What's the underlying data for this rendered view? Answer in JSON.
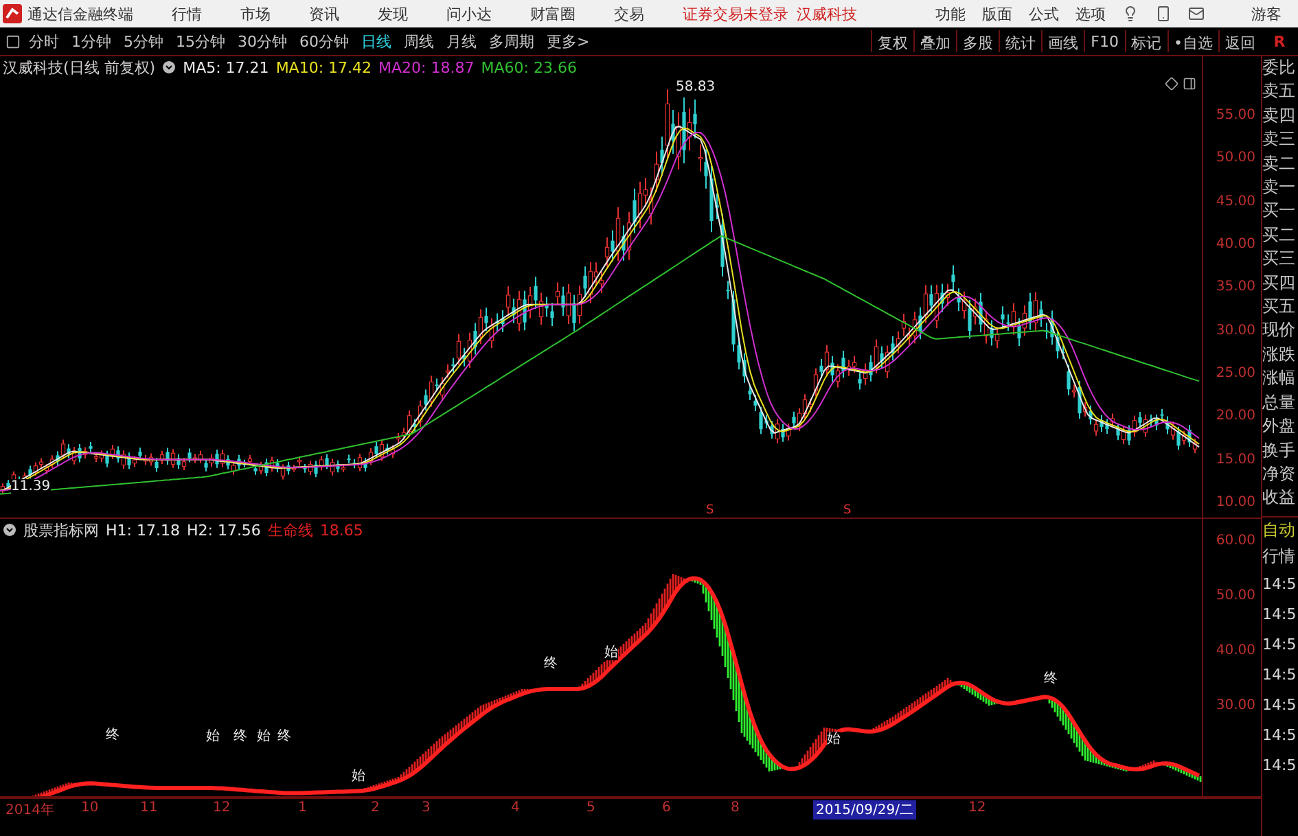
{
  "app": {
    "title": "通达信金融终端"
  },
  "menu": [
    {
      "label": "行情"
    },
    {
      "label": "市场"
    },
    {
      "label": "资讯"
    },
    {
      "label": "发现"
    },
    {
      "label": "问小达"
    },
    {
      "label": "财富圈"
    },
    {
      "label": "交易"
    }
  ],
  "notice": [
    "证券交易未登录",
    "汉威科技"
  ],
  "tools": [
    {
      "label": "功能"
    },
    {
      "label": "版面"
    },
    {
      "label": "公式"
    },
    {
      "label": "选项"
    }
  ],
  "user": "游客",
  "periods": [
    {
      "label": "分时",
      "selected": false
    },
    {
      "label": "1分钟",
      "selected": false
    },
    {
      "label": "5分钟",
      "selected": false
    },
    {
      "label": "15分钟",
      "selected": false
    },
    {
      "label": "30分钟",
      "selected": false
    },
    {
      "label": "60分钟",
      "selected": false
    },
    {
      "label": "日线",
      "selected": true
    },
    {
      "label": "周线",
      "selected": false
    },
    {
      "label": "月线",
      "selected": false
    },
    {
      "label": "多周期",
      "selected": false
    },
    {
      "label": "更多>",
      "selected": false
    }
  ],
  "actions": [
    "复权",
    "叠加",
    "多股",
    "统计",
    "画线",
    "F10",
    "标记",
    "•自选",
    "返回"
  ],
  "corner": "R",
  "price_chart": {
    "title": "汉威科技(日线 前复权)",
    "indicators": [
      {
        "text": "MA5: 17.21",
        "color": "#e8e8e8"
      },
      {
        "text": "MA10: 17.42",
        "color": "#e8e020"
      },
      {
        "text": "MA20: 18.87",
        "color": "#d030d0"
      },
      {
        "text": "MA60: 23.66",
        "color": "#30c030"
      }
    ],
    "high": "58.83",
    "low": "11.39",
    "signals": [
      "S",
      "S"
    ],
    "ticks": [
      "55.00",
      "50.00",
      "45.00",
      "40.00",
      "35.00",
      "30.00",
      "25.00",
      "20.00",
      "15.00",
      "10.00"
    ]
  },
  "indicator_chart": {
    "title": "股票指标网",
    "values": [
      {
        "text": "H1: 17.18",
        "color": "#e8e8e8"
      },
      {
        "text": "H2: 17.56",
        "color": "#e8e8e8"
      },
      {
        "text": "生命线",
        "color": "#e02020"
      },
      {
        "text": "18.65",
        "color": "#e02020"
      }
    ],
    "marks": [
      "终",
      "始",
      "终",
      "始",
      "终",
      "始",
      "终",
      "始",
      "始",
      "终"
    ],
    "ticks": [
      "60.00",
      "50.00",
      "40.00",
      "30.00"
    ]
  },
  "quote_labels": [
    "委比",
    "卖五",
    "卖四",
    "卖三",
    "卖二",
    "卖一",
    "买一",
    "买二",
    "买三",
    "买四",
    "买五",
    "现价",
    "涨跌",
    "涨幅",
    "总量",
    "外盘",
    "换手",
    "净资",
    "收益"
  ],
  "ticker_tabs": [
    "自动",
    "行情"
  ],
  "ticker_times": [
    "14:5",
    "14:5",
    "14:5",
    "14:5",
    "14:5",
    "14:5",
    "14:5"
  ],
  "x_axis": [
    {
      "label": "2014年",
      "selected": false
    },
    {
      "label": "10",
      "selected": false
    },
    {
      "label": "11",
      "selected": false
    },
    {
      "label": "12",
      "selected": false
    },
    {
      "label": "1",
      "selected": false
    },
    {
      "label": "2",
      "selected": false
    },
    {
      "label": "3",
      "selected": false
    },
    {
      "label": "4",
      "selected": false
    },
    {
      "label": "5",
      "selected": false
    },
    {
      "label": "6",
      "selected": false
    },
    {
      "label": "8",
      "selected": false
    },
    {
      "label": "2015/09/29/二",
      "selected": true
    },
    {
      "label": "12",
      "selected": false
    }
  ]
}
